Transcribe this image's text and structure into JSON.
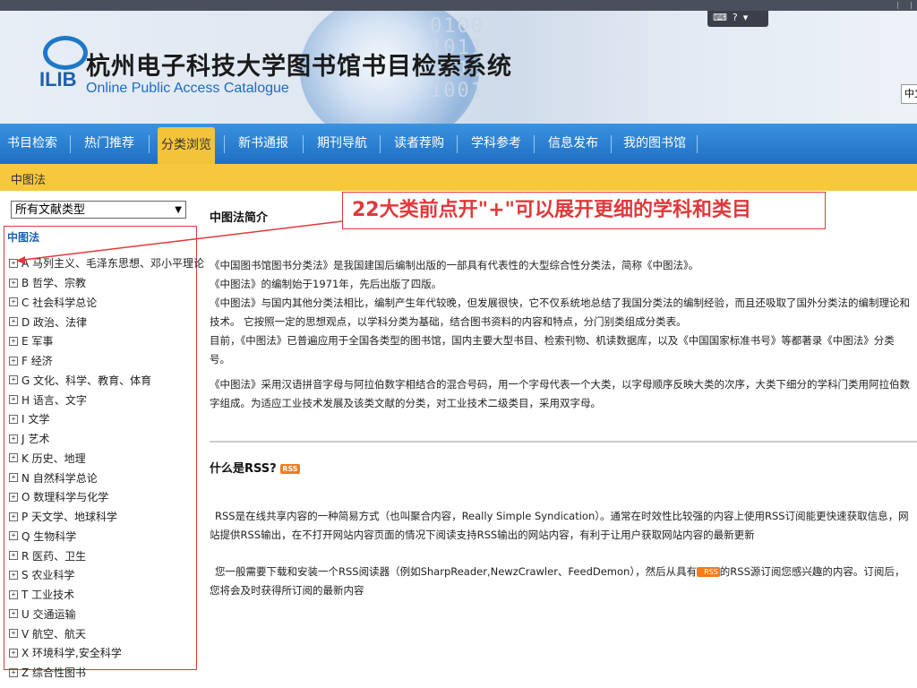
{
  "header": {
    "title": "杭州电子科技大学图书馆书目检索系统",
    "subtitle": "Online Public Access Catalogue",
    "logo_text": "ILIB",
    "binary_text": "0100\n1011\n0010\n1001",
    "lang_label": "中文"
  },
  "nav": {
    "items": [
      {
        "label": "书目检索"
      },
      {
        "label": "热门推荐"
      },
      {
        "label": "分类浏览"
      },
      {
        "label": "新书通报"
      },
      {
        "label": "期刊导航"
      },
      {
        "label": "读者荐购"
      },
      {
        "label": "学科参考"
      },
      {
        "label": "信息发布"
      },
      {
        "label": "我的图书馆"
      }
    ],
    "active_index": 2
  },
  "breadcrumb": "中图法",
  "sidebar": {
    "doc_type_selected": "所有文献类型",
    "tree_title": "中图法",
    "categories": [
      "A 马列主义、毛泽东思想、邓小平理论",
      "B 哲学、宗教",
      "C 社会科学总论",
      "D 政治、法律",
      "E 军事",
      "F 经济",
      "G 文化、科学、教育、体育",
      "H 语言、文字",
      "I 文学",
      "J 艺术",
      "K 历史、地理",
      "N 自然科学总论",
      "O 数理科学与化学",
      "P 天文学、地球科学",
      "Q 生物科学",
      "R 医药、卫生",
      "S 农业科学",
      "T 工业技术",
      "U 交通运输",
      "V 航空、航天",
      "X 环境科学,安全科学",
      "Z 综合性图书"
    ]
  },
  "annotation": "22大类前点开\"+\"可以展开更细的学科和类目",
  "main": {
    "intro_title": "中图法简介",
    "intro_paragraphs": [
      "《中国图书馆图书分类法》是我国建国后编制出版的一部具有代表性的大型综合性分类法，简称《中图法》。",
      "《中图法》的编制始于1971年，先后出版了四版。",
      "《中图法》与国内其他分类法相比，编制产生年代较晚，但发展很快，它不仅系统地总结了我国分类法的编制经验，而且还吸取了国外分类法的编制理论和技术。 它按照一定的思想观点，以学科分类为基础，结合图书资料的内容和特点，分门别类组成分类表。",
      "目前，《中图法》已普遍应用于全国各类型的图书馆，国内主要大型书目、检索刊物、机读数据库，以及《中国国家标准书号》等都著录《中图法》分类号。"
    ],
    "intro_paragraph2": "《中图法》采用汉语拼音字母与阿拉伯数字相结合的混合号码，用一个字母代表一个大类，以字母顺序反映大类的次序，大类下细分的学科门类用阿拉伯数字组成。为适应工业技术发展及该类文献的分类，对工业技术二级类目，采用双字母。",
    "rss_title": "什么是RSS?",
    "rss_badge": "RSS",
    "rss_para1": "RSS是在线共享内容的一种简易方式（也叫聚合内容，Really Simple Syndication）。通常在时效性比较强的内容上使用RSS订阅能更快速获取信息，网站提供RSS输出，在不打开网站内容页面的情况下阅读支持RSS输出的网站内容，有利于让用户获取网站内容的最新更新",
    "rss_para2_before": "您一般需要下载和安装一个RSS阅读器（例如SharpReader,NewzCrawler、FeedDemon），然后从具有",
    "rss_para2_after": "的RSS源订阅您感兴趣的内容。订阅后，您将会及时获得所订阅的最新内容"
  },
  "colors": {
    "nav_blue": "#1e6fc3",
    "active_tab": "#f3c33a",
    "crumb_bar": "#f7c73c",
    "annotation_red": "#e0393b",
    "rss_orange": "#f27b1c"
  }
}
